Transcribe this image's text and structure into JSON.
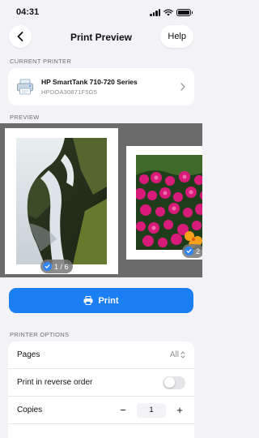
{
  "status_bar": {
    "time": "04:31"
  },
  "nav": {
    "title": "Print Preview",
    "help_label": "Help"
  },
  "current_printer": {
    "section_label": "CURRENT PRINTER",
    "name": "HP SmartTank 710-720 Series",
    "id": "HPDOA30871F5G5"
  },
  "preview": {
    "section_label": "PREVIEW",
    "pages": [
      {
        "badge": "1 / 6",
        "photo": "waterfall"
      },
      {
        "badge": "2",
        "photo": "flowers"
      }
    ]
  },
  "print_button": {
    "label": "Print"
  },
  "printer_options": {
    "section_label": "PRINTER OPTIONS",
    "pages": {
      "label": "Pages",
      "value": "All"
    },
    "reverse_order": {
      "label": "Print in reverse order",
      "on": false
    },
    "copies": {
      "label": "Copies",
      "value": "1",
      "minus": "−",
      "plus": "+"
    }
  },
  "colors": {
    "accent": "#1a7ff2",
    "background": "#f2f2f7"
  }
}
